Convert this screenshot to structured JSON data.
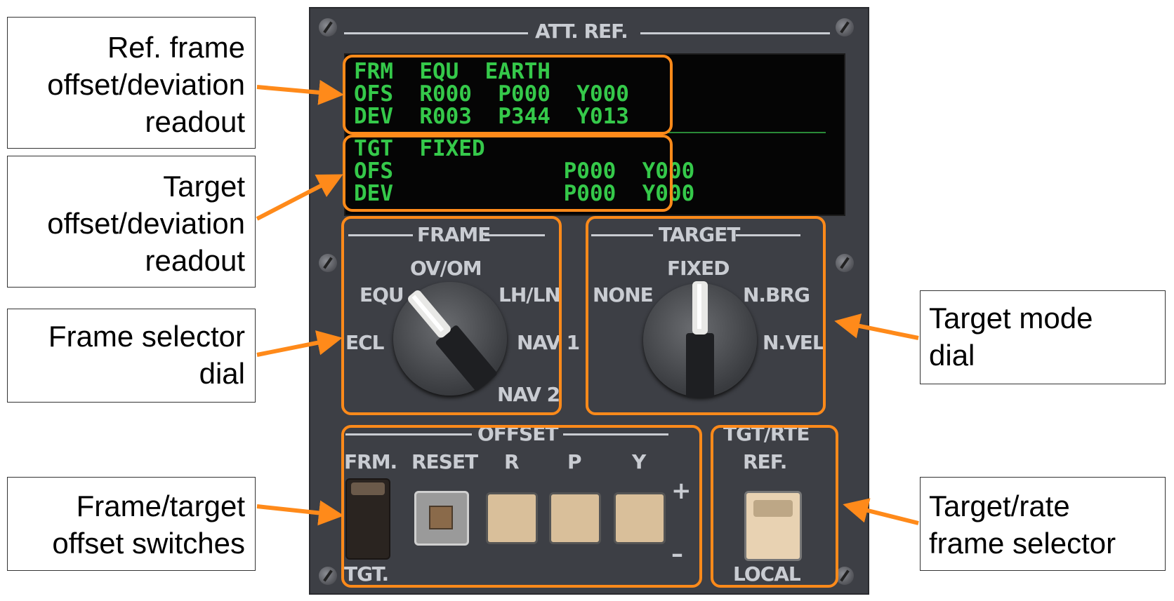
{
  "callouts": {
    "ref_frame": [
      "Ref. frame",
      "offset/deviation",
      "readout"
    ],
    "target_readout": [
      "Target",
      "offset/deviation",
      "readout"
    ],
    "frame_dial": [
      "Frame selector",
      "dial"
    ],
    "offset_switches": [
      "Frame/target",
      "offset switches"
    ],
    "target_mode": [
      "Target mode",
      "dial"
    ],
    "tgt_rate": [
      "Target/rate",
      "frame selector"
    ]
  },
  "panel": {
    "title": "ATT. REF.",
    "display": {
      "row1": "FRM  EQU  EARTH",
      "row2": "OFS  R000  P000  Y000",
      "row3": "DEV  R003  P344  Y013",
      "row4": "TGT  FIXED",
      "row5": "OFS             P000  Y000",
      "row6": "DEV             P000  Y000"
    },
    "frame": {
      "title": "FRAME",
      "opt_ovom": "OV/OM",
      "opt_equ": "EQU",
      "opt_lhln": "LH/LN",
      "opt_ecl": "ECL",
      "opt_nav1": "NAV 1",
      "opt_nav2": "NAV 2"
    },
    "target": {
      "title": "TARGET",
      "opt_fixed": "FIXED",
      "opt_none": "NONE",
      "opt_nbrg": "N.BRG",
      "opt_nvel": "N.VEL"
    },
    "offset": {
      "title": "OFFSET",
      "frm": "FRM.",
      "reset": "RESET",
      "r": "R",
      "p": "P",
      "y": "Y",
      "plus": "+",
      "minus": "–",
      "tgt": "TGT."
    },
    "tgtrte": {
      "title": "TGT/RTE",
      "ref": "REF.",
      "local": "LOCAL"
    }
  },
  "colors": {
    "highlight": "#ff8a1a",
    "mfd": "#35c94a",
    "panel": "#3d3f45"
  }
}
